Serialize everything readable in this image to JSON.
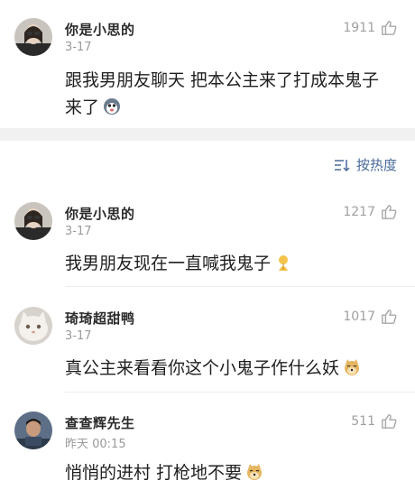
{
  "top_comment": {
    "username": "你是小思的",
    "date": "3-17",
    "likes": "1911",
    "text_line1": "跟我男朋友聊天 把本公主来了打成本鬼子",
    "text_line2": "来了"
  },
  "sort_control": {
    "label": "按热度"
  },
  "replies": [
    {
      "username": "你是小思的",
      "date": "3-17",
      "likes": "1217",
      "text": "我男朋友现在一直喊我鬼子"
    },
    {
      "username": "琦琦超甜鸭",
      "date": "3-17",
      "likes": "1017",
      "text": "真公主来看看你这个小鬼子作什么妖"
    },
    {
      "username": "查查辉先生",
      "date": "昨天 00:15",
      "likes": "511",
      "text": "悄悄的进村 打枪地不要"
    }
  ],
  "colors": {
    "link_blue": "#4a6a9a",
    "muted_gray": "#9a9a9a",
    "separator": "#f1f1f1"
  }
}
